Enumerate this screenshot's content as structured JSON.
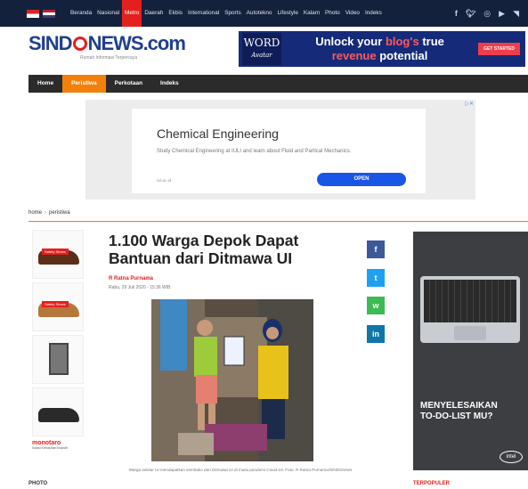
{
  "topnav": {
    "links": [
      "Beranda",
      "Nasional",
      "Metro",
      "Daerah",
      "Ekbis",
      "International",
      "Sports",
      "Autotekno",
      "Lifestyle",
      "Kalam",
      "Photo",
      "Video",
      "Indeks"
    ],
    "active_index": 2,
    "social_icons": [
      "facebook-icon",
      "twitter-icon",
      "instagram-icon",
      "youtube-icon",
      "rss-icon"
    ]
  },
  "header": {
    "logo_text_left": "SIND",
    "logo_text_right": "NEWS.com",
    "tagline": "Rumah Informasi Terpercaya"
  },
  "banner": {
    "logo_word": "WORD",
    "logo_script": "Avatar",
    "line1_prefix": "Unlock your ",
    "line1_highlight": "blog's",
    "line1_suffix": " true",
    "line2_highlight": "revenue",
    "line2_suffix": " potential",
    "button": "GET STARTED"
  },
  "secnav": {
    "items": [
      "Home",
      "Peristiwa",
      "Perkotaan",
      "Indeks"
    ],
    "active_index": 1
  },
  "ad": {
    "title": "Chemical Engineering",
    "description": "Study Chemical Engineering at IULI and learn about Fluid and Partical Mechanics.",
    "url": "iuli.ac.id",
    "button": "OPEN"
  },
  "breadcrumb": {
    "items": [
      "home",
      "peristiwa"
    ]
  },
  "products": {
    "tags": [
      "Safety Shoes",
      "Safety Shoes"
    ],
    "brand": "monotaro",
    "brand_sub": "Solusi Kebutuhan Industri"
  },
  "article": {
    "headline": "1.100 Warga Depok Dapat Bantuan dari Ditmawa UI",
    "author": "R Ratna Purnama",
    "date": "Rabu, 29 Juli 2020 - 15:36 WIB",
    "caption": "Warga sekitar UI mendapatkan sembako dari Ditmawa UI di masa pandemi Covid-19. Foto: R Ratna Purnama/SINDOnews"
  },
  "share": {
    "facebook": "f",
    "twitter": "t",
    "whatsapp": "w",
    "linkedin": "in"
  },
  "rightad": {
    "headline_line1": "MENYELESAIKAN",
    "headline_line2": "TO-DO-LIST MU?",
    "brand": "intel"
  },
  "footer": {
    "left": "PHOTO",
    "right": "TERPOPULER"
  },
  "colors": {
    "brand_blue": "#1f3f8f",
    "brand_red": "#e4201f",
    "accent_orange": "#f2800a",
    "topbar": "#14213d"
  }
}
